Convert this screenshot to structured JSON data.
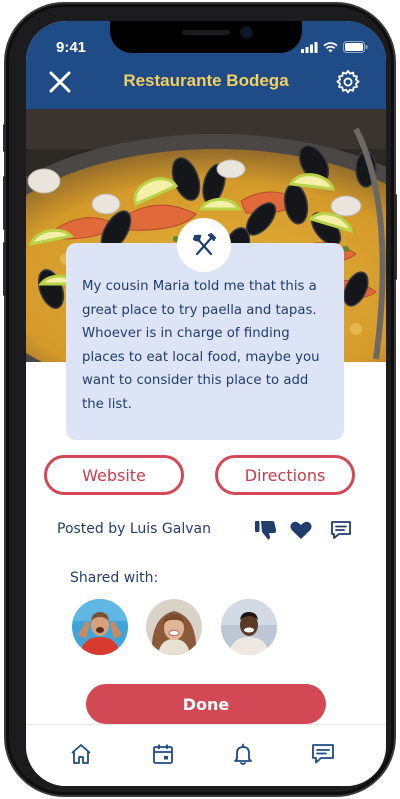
{
  "status_bar": {
    "time": "9:41"
  },
  "header": {
    "title": "Restaurante Bodega",
    "close_icon": "close-icon",
    "settings_icon": "gear-icon",
    "background_color": "#1f4b86",
    "title_color": "#f2cf63"
  },
  "hero": {
    "description_icon": "fork-knife-icon"
  },
  "message": {
    "text": "My cousin Maria told me that this a great place to try paella and tapas. Whoever is in charge of finding places to eat local food, maybe you want to consider this place to add the list."
  },
  "actions": {
    "website_label": "Website",
    "directions_label": "Directions"
  },
  "post": {
    "posted_by": "Posted by Luis Galvan",
    "icons": [
      "thumbs-down-icon",
      "heart-icon",
      "comment-icon"
    ]
  },
  "shared": {
    "label": "Shared with:",
    "avatars": 3
  },
  "done_label": "Done",
  "tabbar": {
    "items": [
      "home-icon",
      "calendar-icon",
      "bell-icon",
      "messages-icon"
    ]
  },
  "colors": {
    "accent": "#d24855",
    "text": "#1f3e6e",
    "card": "#dde4f6"
  }
}
